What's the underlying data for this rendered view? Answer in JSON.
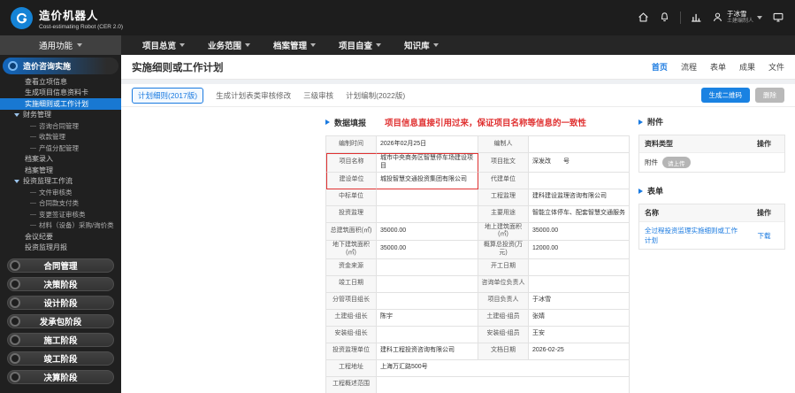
{
  "colors": {
    "accent": "#1a7ae0",
    "annotation_red": "#e03131"
  },
  "header": {
    "brand": {
      "title": "造价机器人",
      "subtitle": "Cost-estimating Robot (CER 2.0)"
    },
    "user": {
      "name": "于冰雪",
      "role": "土建编制人"
    }
  },
  "navbar": {
    "left_label": "通用功能",
    "items": [
      "项目总览",
      "业务范围",
      "档案管理",
      "项目自查",
      "知识库"
    ]
  },
  "sidebar": {
    "header": "造价咨询实施",
    "items": [
      {
        "label": "查看立项信息"
      },
      {
        "label": "生成项目信息资料卡"
      },
      {
        "label": "实施细则或工作计划",
        "active": true
      },
      {
        "label": "财务管理",
        "group": true
      },
      {
        "label": "咨询合同管理",
        "is_sub": true
      },
      {
        "label": "收款管理",
        "is_sub": true
      },
      {
        "label": "产值分配管理",
        "is_sub": true
      },
      {
        "label": "档案录入"
      },
      {
        "label": "档案管理"
      },
      {
        "label": "投资监理工作流",
        "group": true
      },
      {
        "label": "文件审核类",
        "is_sub": true
      },
      {
        "label": "合同款支付类",
        "is_sub": true
      },
      {
        "label": "变更签证审核类",
        "is_sub": true
      },
      {
        "label": "材料（设备）采购/询价类",
        "is_sub": true
      },
      {
        "label": "会议纪要"
      },
      {
        "label": "投资监理月报"
      }
    ],
    "stages": [
      "合同管理",
      "决策阶段",
      "设计阶段",
      "发承包阶段",
      "施工阶段",
      "竣工阶段",
      "决算阶段"
    ]
  },
  "page": {
    "title": "实施细则或工作计划",
    "links": [
      {
        "label": "首页",
        "active": true
      },
      {
        "label": "流程"
      },
      {
        "label": "表单"
      },
      {
        "label": "成果"
      },
      {
        "label": "文件"
      }
    ],
    "tabs": [
      {
        "label": "计划细则(2017版)",
        "active": true
      },
      {
        "label": "生成计划表类审核修改"
      },
      {
        "label": "三级审核"
      },
      {
        "label": "计划编制(2022版)"
      }
    ],
    "actions": {
      "qrcode": "生成二维码",
      "delete": "删除"
    }
  },
  "form": {
    "title": "数据填报",
    "annotation": "项目信息直接引用过来，保证项目名称等信息的一致性",
    "rows": [
      {
        "l1": "编制时间",
        "v1": "2026年02月25日",
        "l2": "编制人",
        "v2": ""
      },
      {
        "l1": "项目名称",
        "v1": "城市中央商务区智慧停车场建设项目",
        "l2": "项目批文",
        "v2": "深发改　　号",
        "annotated": true
      },
      {
        "l1": "建设单位",
        "v1": "城投智慧交通投资集团有限公司",
        "l2": "代建单位",
        "v2": "",
        "annotated": true
      },
      {
        "l1": "中标单位",
        "v1": "",
        "l2": "工程监理",
        "v2": "建科建设监理咨询有限公司"
      },
      {
        "l1": "投资监理",
        "v1": "",
        "l2": "主要用途",
        "v2": "智能立体停车、配套智慧交通服务"
      },
      {
        "l1": "总建筑面积(㎡)",
        "v1": "35000.00",
        "l2": "地上建筑面积(㎡)",
        "v2": "35000.00"
      },
      {
        "l1": "地下建筑面积(㎡)",
        "v1": "35000.00",
        "l2": "概算总投资(万元)",
        "v2": "12000.00"
      },
      {
        "l1": "资金来源",
        "v1": "",
        "l2": "开工日期",
        "v2": ""
      },
      {
        "l1": "竣工日期",
        "v1": "",
        "l2": "咨询单位负责人",
        "v2": ""
      },
      {
        "l1": "分管项目组长",
        "v1": "",
        "l2": "项目负责人",
        "v2": "于冰雪"
      },
      {
        "l1": "土建组-组长",
        "v1": "陈宇",
        "l2": "土建组-组员",
        "v2": "张婧"
      },
      {
        "l1": "安装组-组长",
        "v1": "",
        "l2": "安装组-组员",
        "v2": "王安"
      },
      {
        "l1": "投资监理单位",
        "v1": "建科工程投资咨询有限公司",
        "l2": "文档日期",
        "v2": "2026-02-25"
      },
      {
        "l1": "工程地址",
        "v1": "上海万汇路500号",
        "span": true
      },
      {
        "l1": "工程概述范围",
        "v1": "",
        "span": true
      }
    ]
  },
  "attachments": {
    "title": "附件",
    "headers": {
      "type": "资料类型",
      "action": "操作"
    },
    "rows": [
      {
        "label": "附件",
        "button": "请上传",
        "action": ""
      }
    ]
  },
  "forms_panel": {
    "title": "表单",
    "headers": {
      "name": "名称",
      "action": "操作"
    },
    "rows": [
      {
        "name": "全过程投资监理实施细则或工作计划",
        "action": "下载"
      }
    ]
  }
}
